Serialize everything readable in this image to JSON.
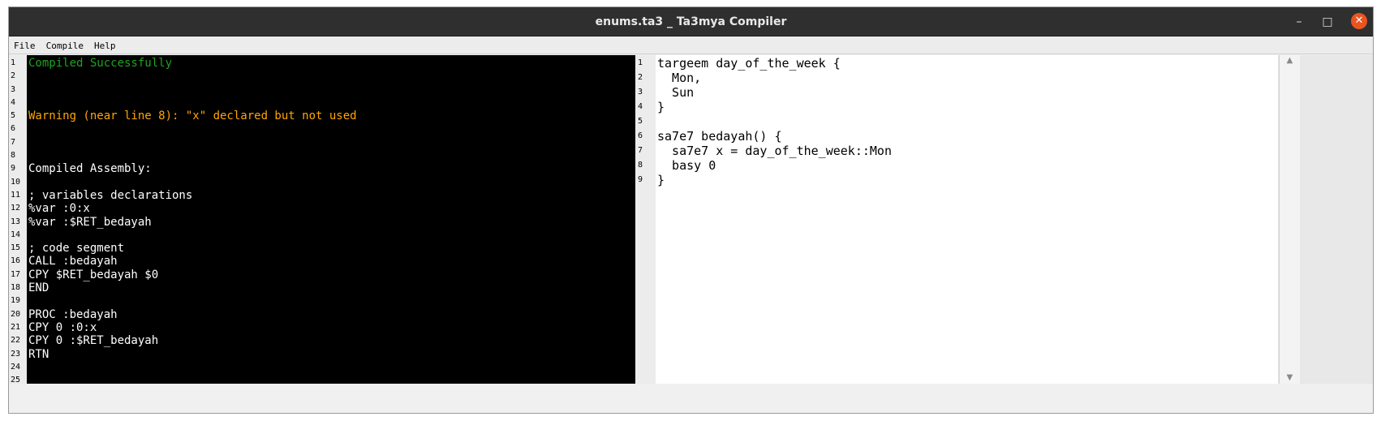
{
  "window": {
    "title": "enums.ta3 _ Ta3mya Compiler",
    "controls": {
      "minimize": "–",
      "maximize": "□",
      "close": "✕"
    }
  },
  "menu": [
    "File",
    "Compile",
    "Help"
  ],
  "console": {
    "line_numbers": [
      "1",
      "2",
      "3",
      "4",
      "5",
      "6",
      "7",
      "8",
      "9",
      "10",
      "11",
      "12",
      "13",
      "14",
      "15",
      "16",
      "17",
      "18",
      "19",
      "20",
      "21",
      "22",
      "23",
      "24",
      "25"
    ],
    "lines": [
      "Compiled Successfully",
      "",
      "",
      "",
      "Warning (near line 8): \"x\" declared but not used",
      "",
      "",
      "",
      "Compiled Assembly:",
      "",
      "; variables declarations",
      "%var :0:x",
      "%var :$RET_bedayah",
      "",
      "; code segment",
      "CALL :bedayah",
      "CPY $RET_bedayah $0",
      "END",
      "",
      "PROC :bedayah",
      "CPY 0 :0:x",
      "CPY 0 :$RET_bedayah",
      "RTN",
      "",
      ""
    ],
    "colors": {
      "success": "#1fa31f",
      "warning": "#ffa500",
      "text": "#ffffff",
      "background": "#000000"
    }
  },
  "editor": {
    "line_numbers": [
      "1",
      "2",
      "3",
      "4",
      "5",
      "6",
      "7",
      "8",
      "9"
    ],
    "lines": [
      "targeem day_of_the_week {",
      "  Mon,",
      "  Sun",
      "}",
      "",
      "sa7e7 bedayah() {",
      "  sa7e7 x = day_of_the_week::Mon",
      "  basy 0",
      "}"
    ]
  }
}
